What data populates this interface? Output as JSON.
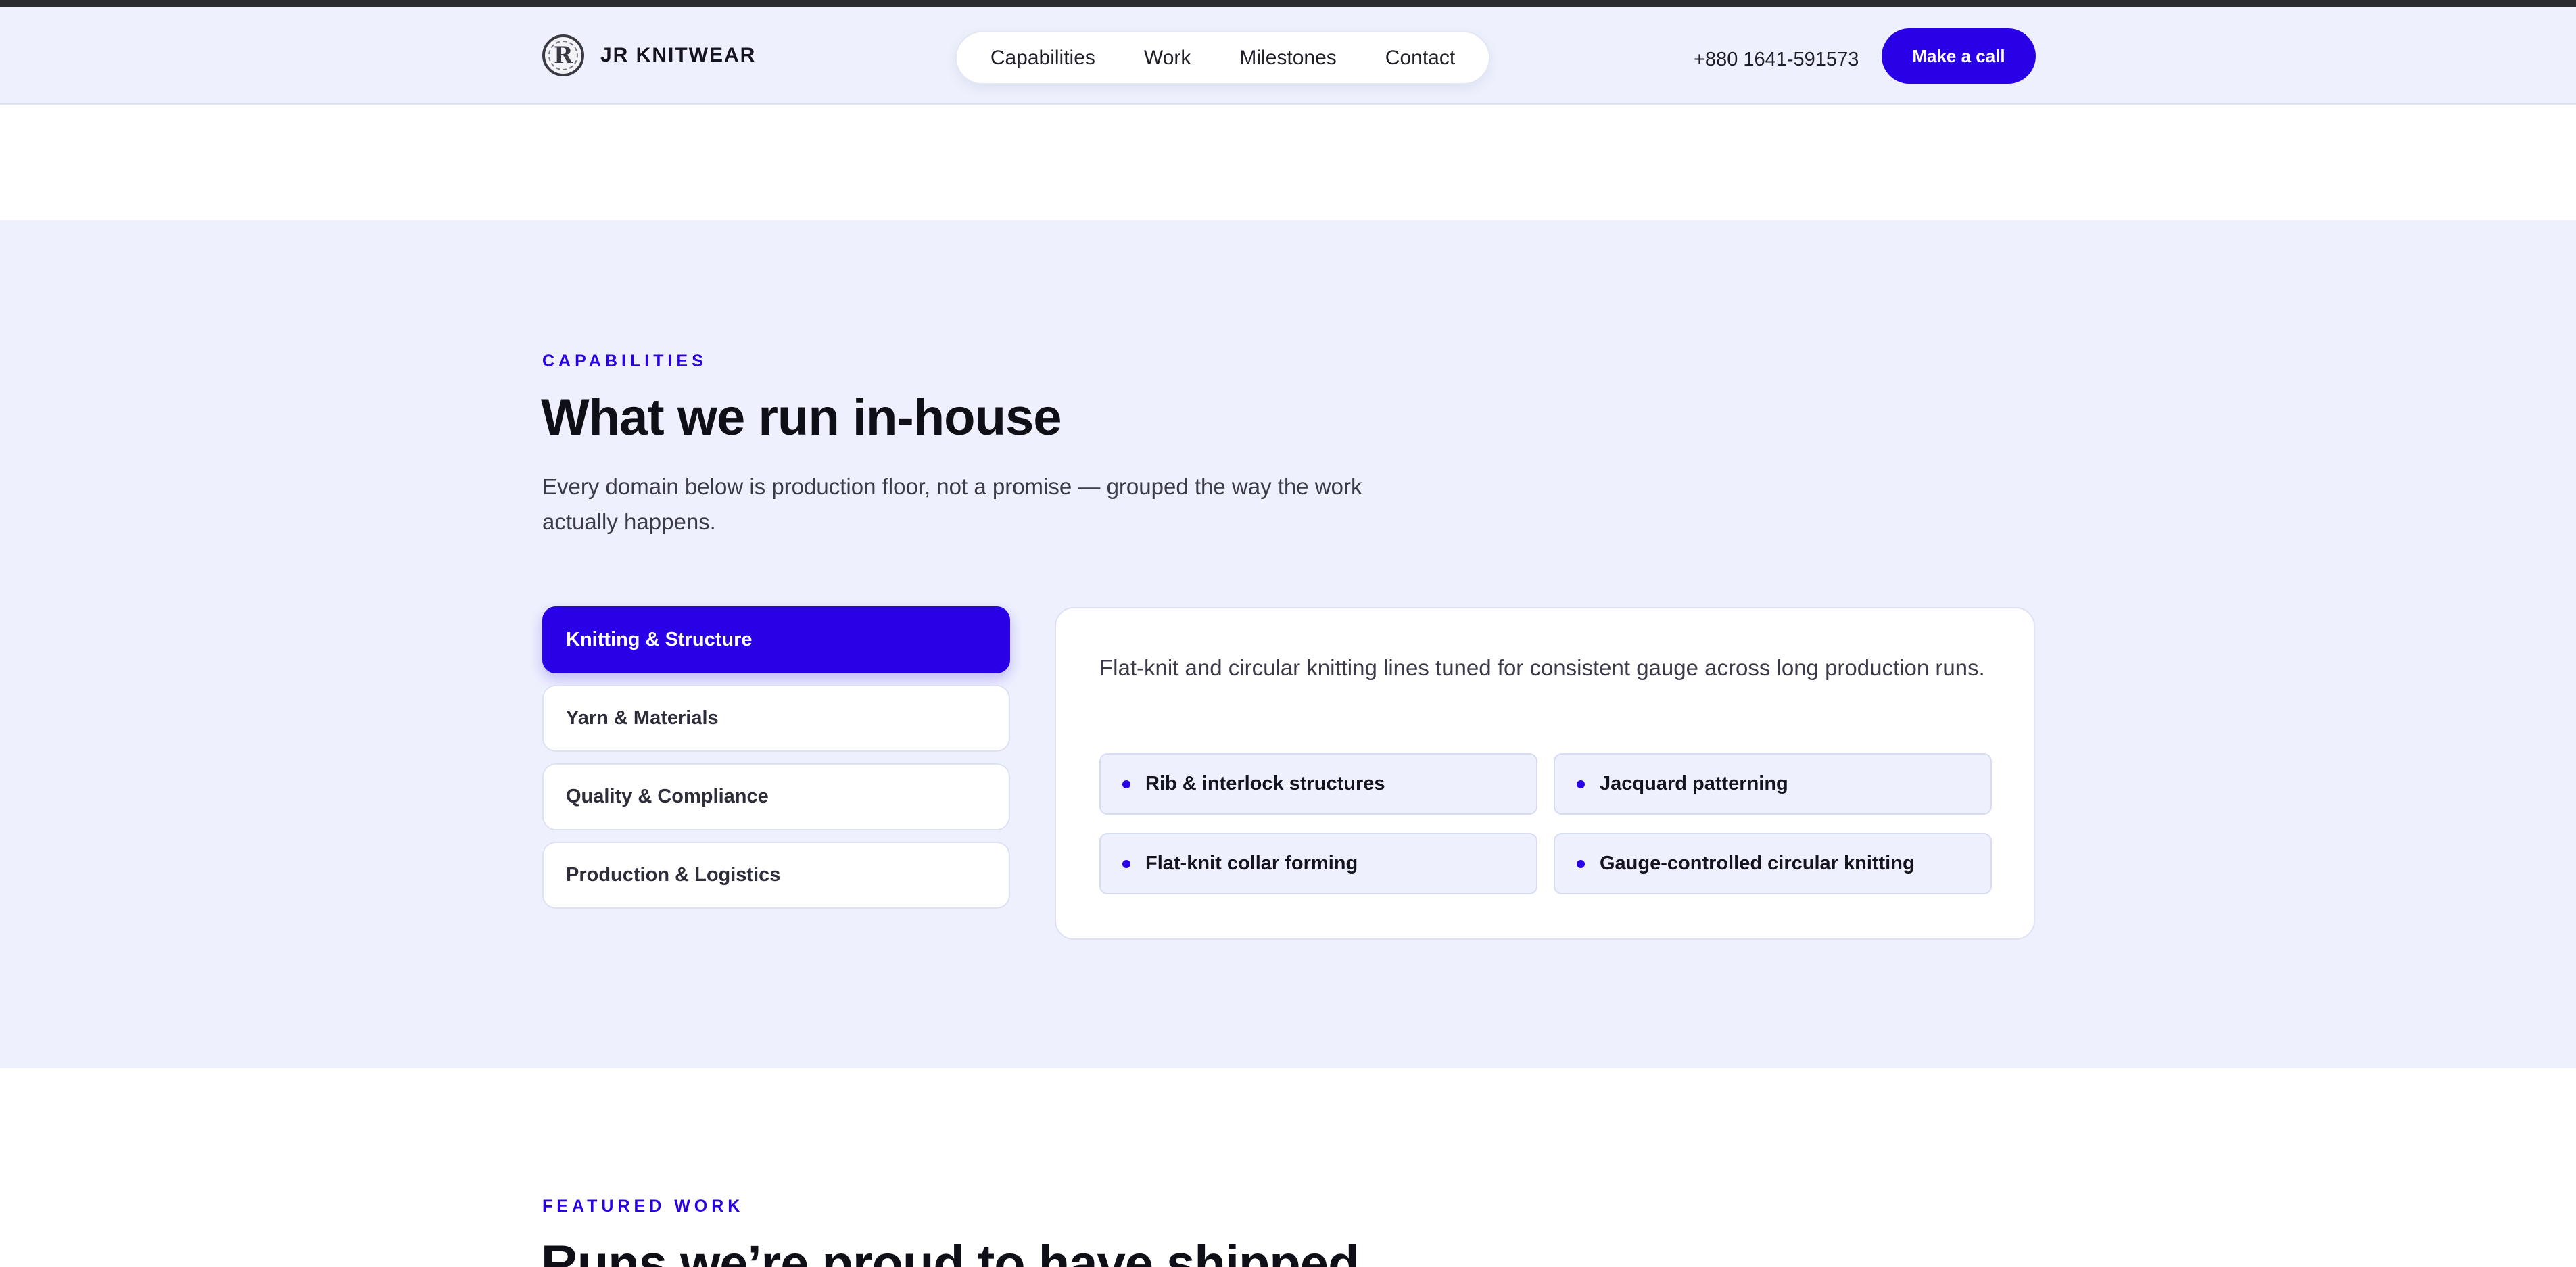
{
  "header": {
    "brand_name": "JR KNITWEAR",
    "logo_letter": "R",
    "nav": [
      "Capabilities",
      "Work",
      "Milestones",
      "Contact"
    ],
    "phone": "+880 1641-591573",
    "cta_label": "Make a call"
  },
  "capabilities": {
    "eyebrow": "CAPABILITIES",
    "title": "What we run in-house",
    "lead": "Every domain below is production floor, not a promise — grouped the way the work actually happens.",
    "tabs": [
      "Knitting & Structure",
      "Yarn & Materials",
      "Quality & Compliance",
      "Production & Logistics"
    ],
    "active_tab": "Knitting & Structure",
    "panel": {
      "description": "Flat-knit and circular knitting lines tuned for consistent gauge across long production runs.",
      "features": [
        "Rib & interlock structures",
        "Jacquard patterning",
        "Flat-knit collar forming",
        "Gauge-controlled circular knitting"
      ]
    }
  },
  "featured_work": {
    "eyebrow": "FEATURED WORK",
    "title": "Runs we’re proud to have shipped"
  },
  "colors": {
    "accent": "#2a00e6",
    "section_bg": "#eef1fd"
  }
}
